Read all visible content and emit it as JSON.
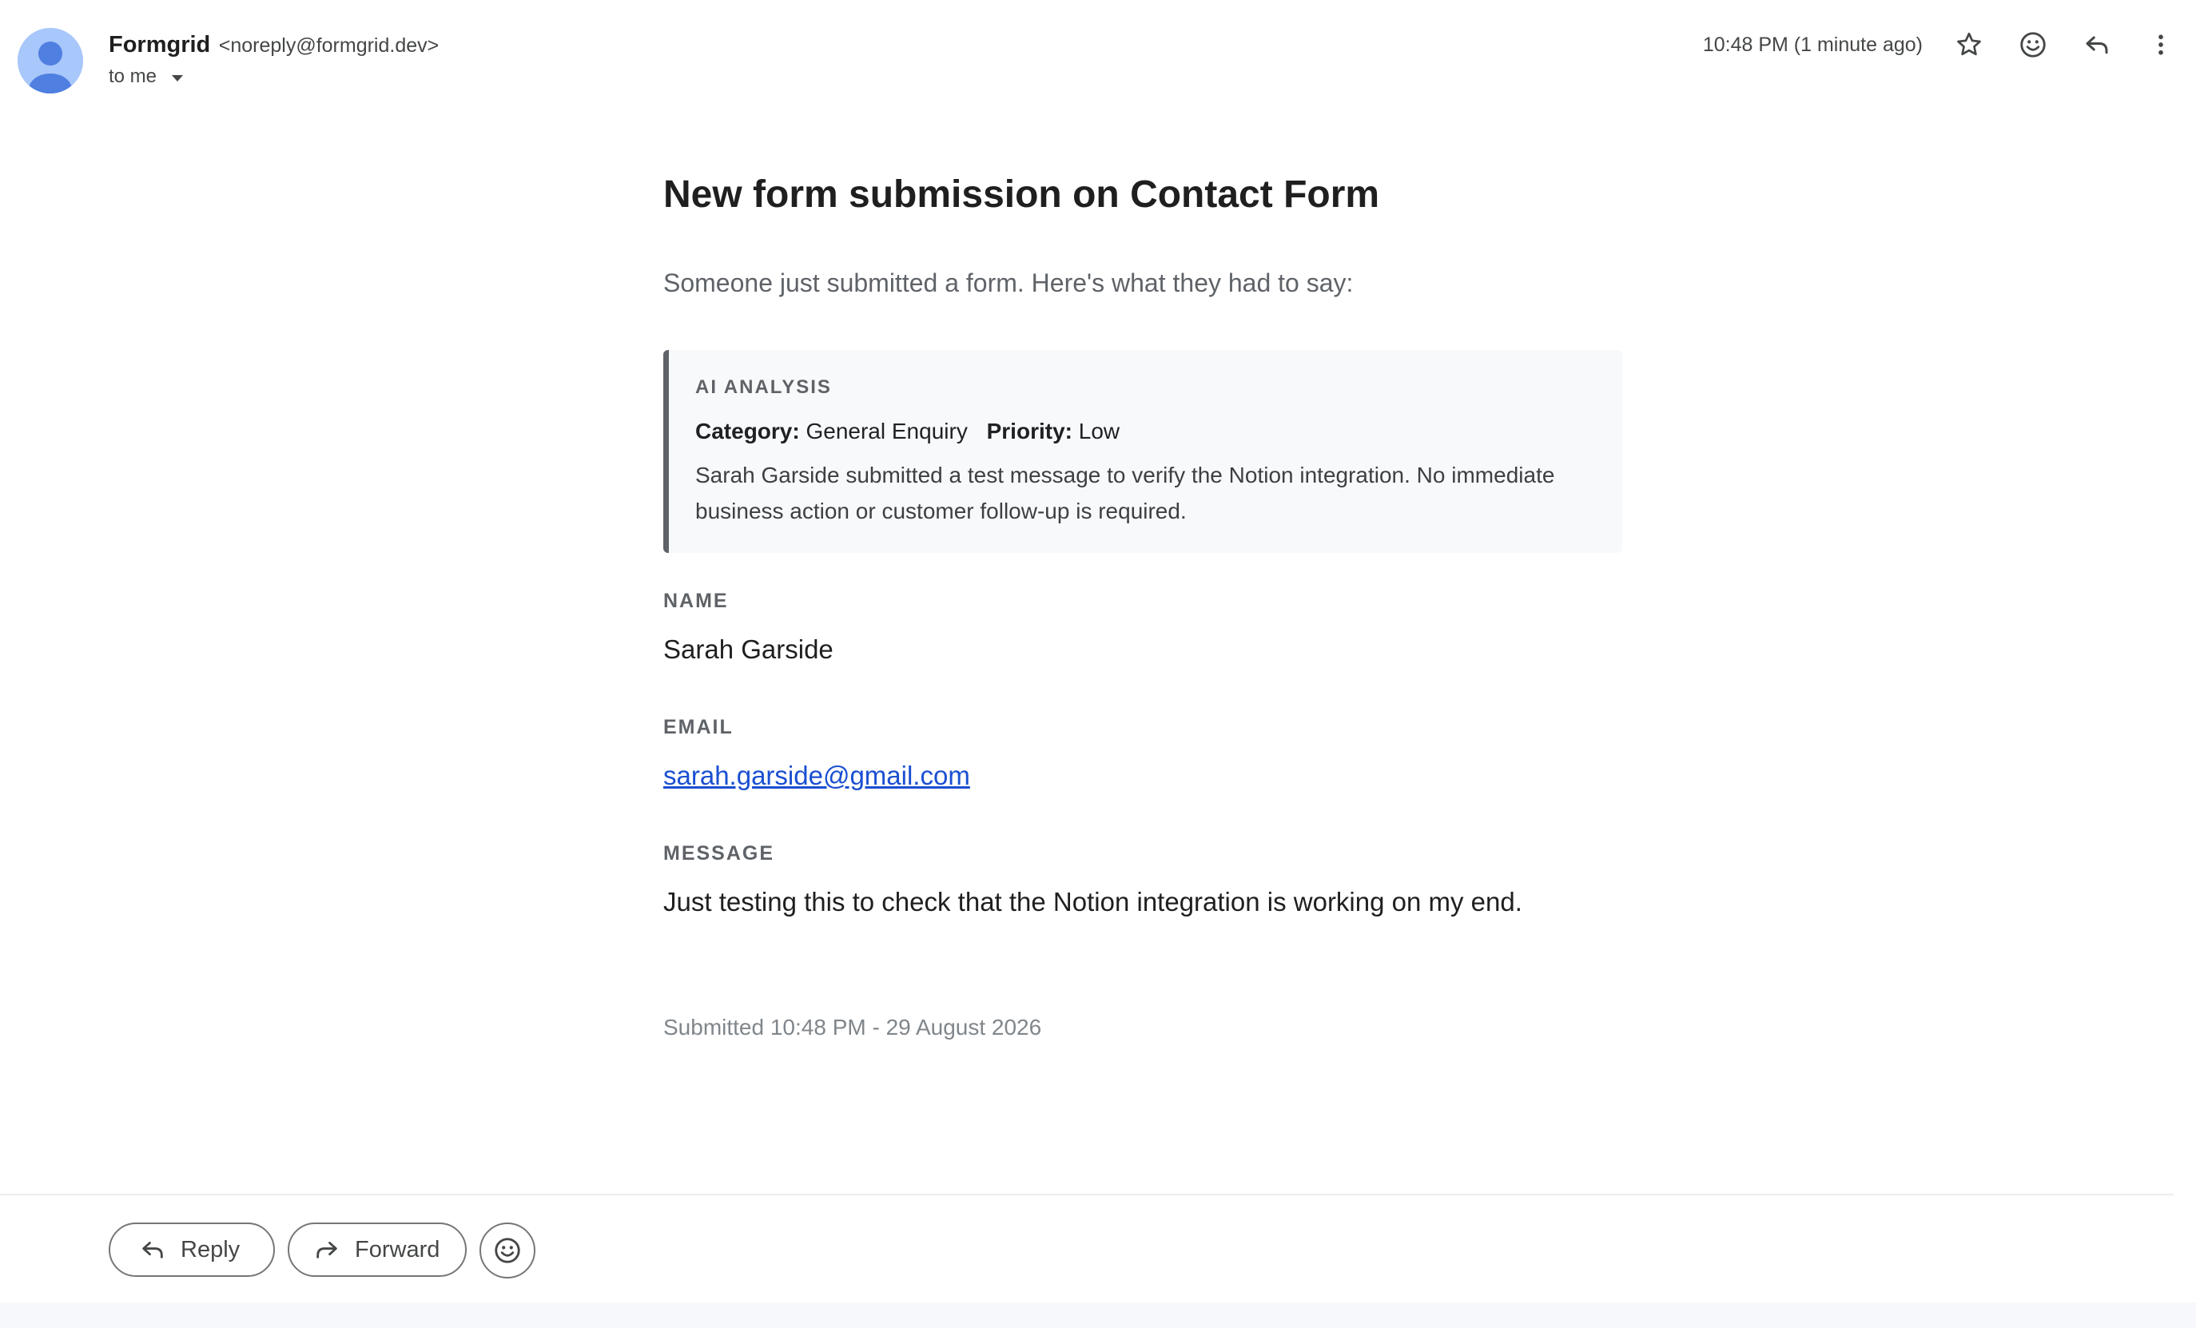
{
  "header": {
    "sender_name": "Formgrid",
    "sender_email": "<noreply@formgrid.dev>",
    "recipient": "to me",
    "timestamp": "10:48 PM (1 minute ago)",
    "icons": [
      "avatar-icon",
      "caret-down-icon",
      "star-icon",
      "emoji-icon",
      "reply-icon",
      "more-vertical-icon"
    ]
  },
  "email": {
    "title": "New form submission on Contact Form",
    "intro": "Someone just submitted a form. Here's what they had to say:",
    "ai_analysis": {
      "heading": "AI ANALYSIS",
      "category_label": "Category:",
      "category_value": "General Enquiry",
      "priority_label": "Priority:",
      "priority_value": "Low",
      "summary": "Sarah Garside submitted a test message to verify the Notion integration. No immediate business action or customer follow-up is required."
    },
    "fields": [
      {
        "label": "NAME",
        "value": "Sarah Garside"
      },
      {
        "label": "EMAIL",
        "value": "sarah.garside@gmail.com"
      },
      {
        "label": "MESSAGE",
        "value": "Just testing this to check that the Notion integration is working on my end."
      }
    ],
    "submitted": "Submitted 10:48 PM - 29 August 2026"
  },
  "footer": {
    "reply_label": "Reply",
    "forward_label": "Forward",
    "icons": [
      "reply-icon",
      "forward-icon",
      "emoji-icon"
    ]
  },
  "colors": {
    "link": "#1a4fd1",
    "ai_border": "#5f6368",
    "ai_background": "#f8f9fa",
    "avatar_background": "#a8c7fa",
    "avatar_figure": "#4f7fe0"
  }
}
